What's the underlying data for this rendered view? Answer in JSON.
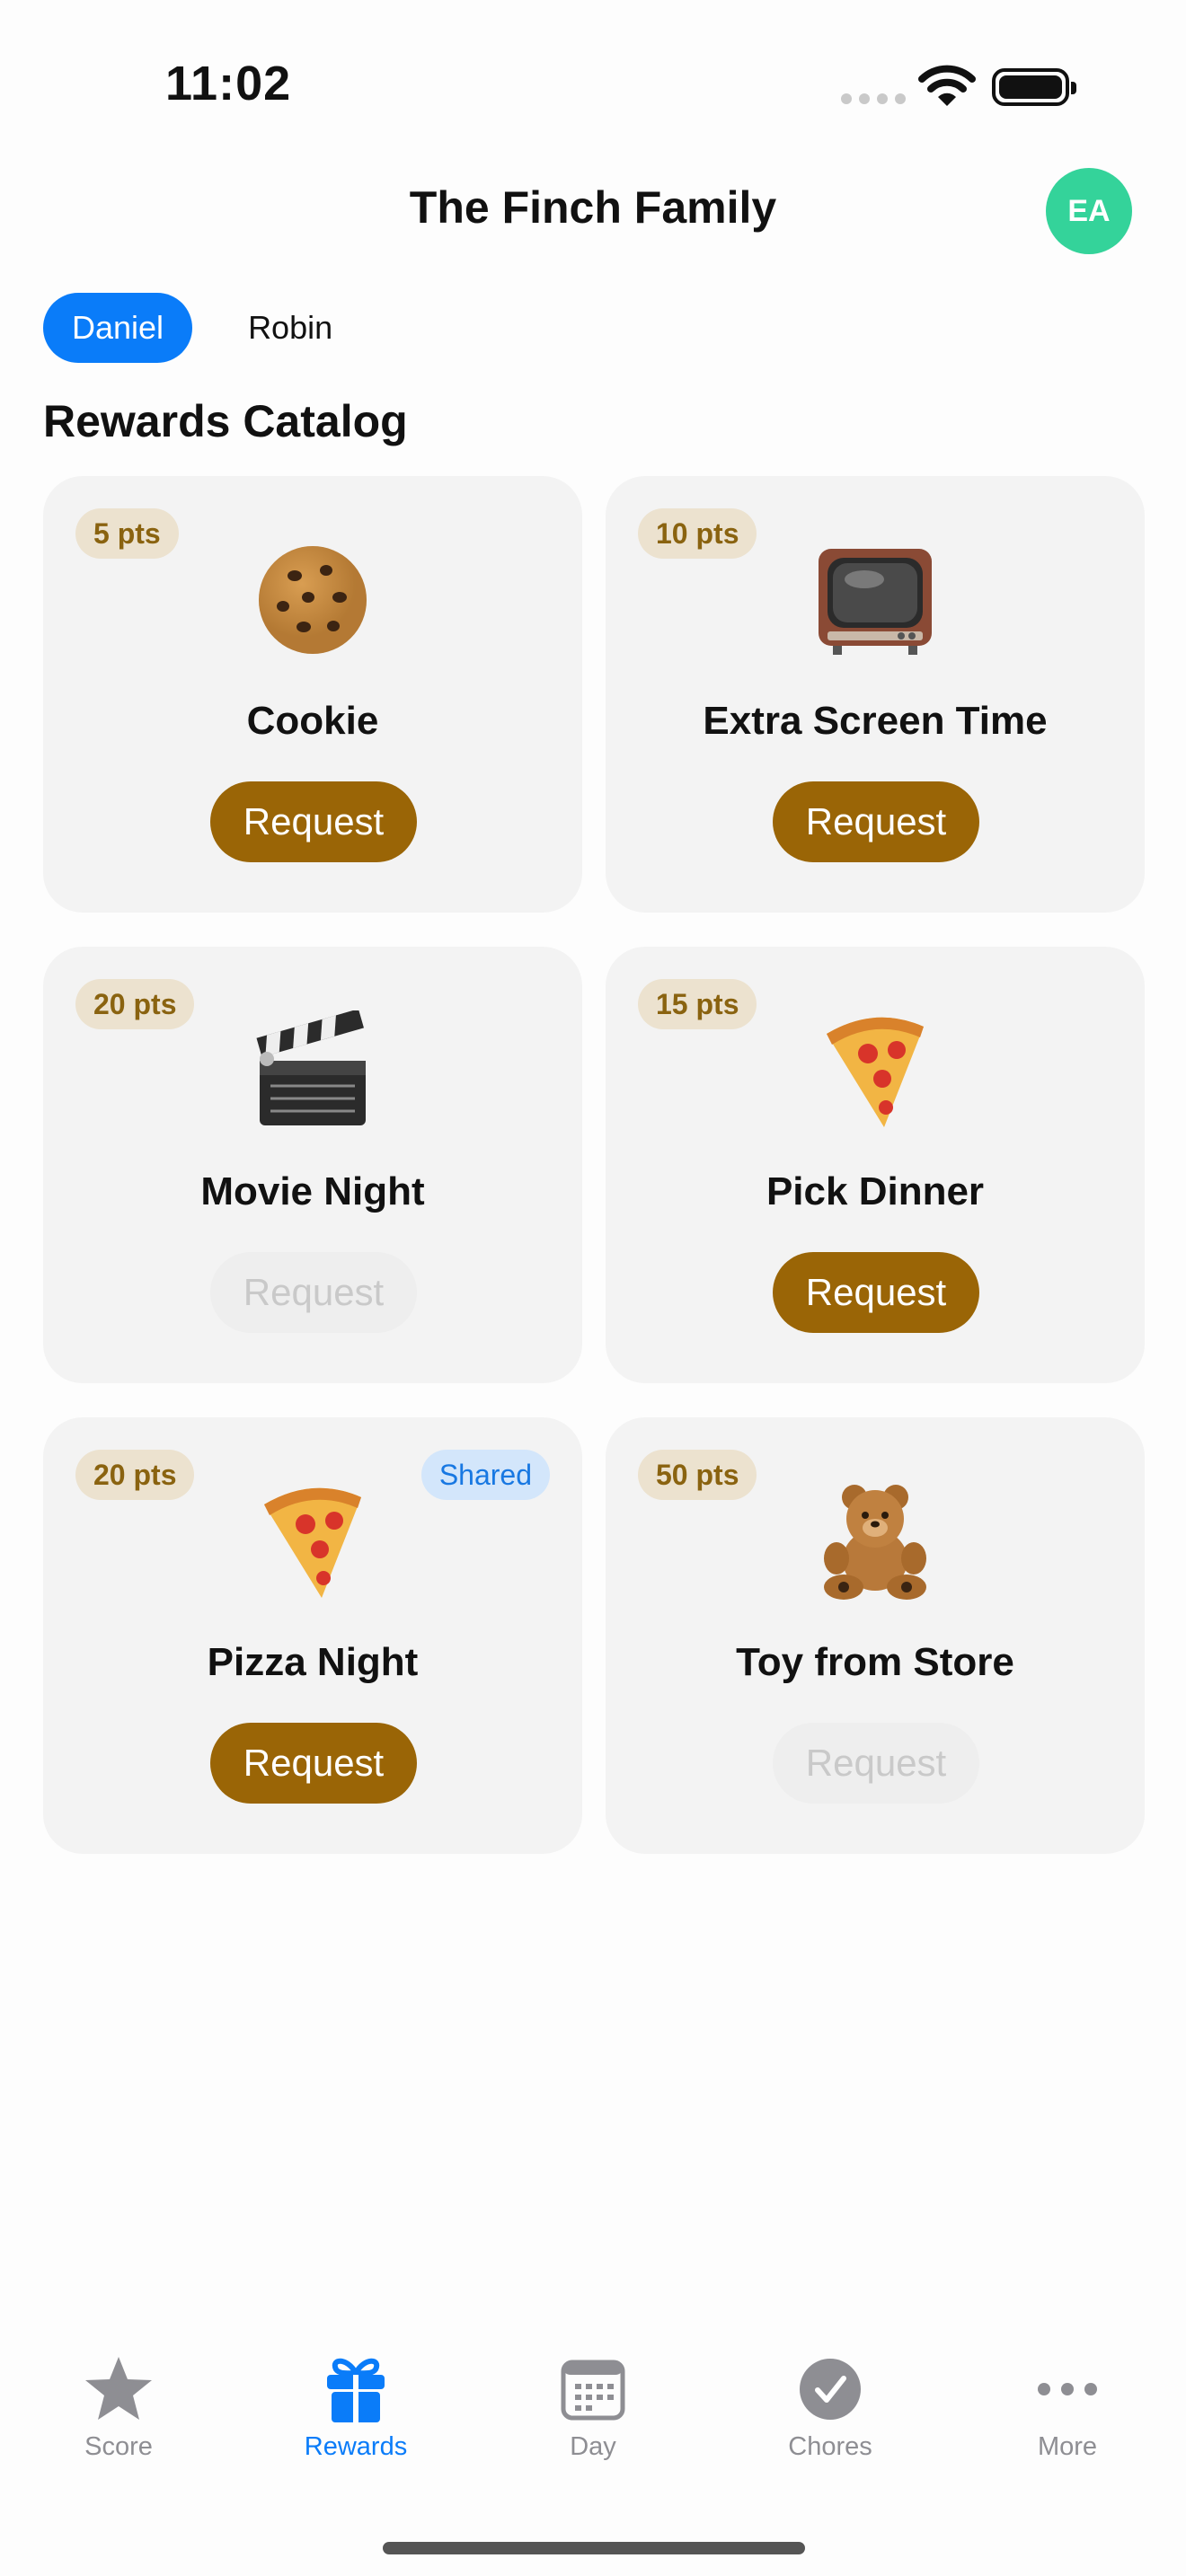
{
  "status_bar": {
    "time": "11:02"
  },
  "header": {
    "title": "The Finch Family",
    "avatar_initials": "EA",
    "avatar_color": "#34d39a"
  },
  "members": [
    {
      "label": "Daniel",
      "selected": true
    },
    {
      "label": "Robin",
      "selected": false
    }
  ],
  "section_title": "Rewards Catalog",
  "rewards": [
    {
      "points": "5 pts",
      "icon": "cookie-icon",
      "name": "Cookie",
      "request_label": "Request",
      "enabled": true,
      "shared": ""
    },
    {
      "points": "10 pts",
      "icon": "television-icon",
      "name": "Extra Screen Time",
      "request_label": "Request",
      "enabled": true,
      "shared": ""
    },
    {
      "points": "20 pts",
      "icon": "clapperboard-icon",
      "name": "Movie Night",
      "request_label": "Request",
      "enabled": false,
      "shared": ""
    },
    {
      "points": "15 pts",
      "icon": "pizza-slice-icon",
      "name": "Pick Dinner",
      "request_label": "Request",
      "enabled": true,
      "shared": ""
    },
    {
      "points": "20 pts",
      "icon": "pizza-slice-icon",
      "name": "Pizza Night",
      "request_label": "Request",
      "enabled": true,
      "shared": "Shared"
    },
    {
      "points": "50 pts",
      "icon": "teddy-bear-icon",
      "name": "Toy from Store",
      "request_label": "Request",
      "enabled": false,
      "shared": ""
    }
  ],
  "tab_bar": [
    {
      "label": "Score",
      "icon": "star-icon",
      "active": false
    },
    {
      "label": "Rewards",
      "icon": "gift-icon",
      "active": true
    },
    {
      "label": "Day",
      "icon": "calendar-icon",
      "active": false
    },
    {
      "label": "Chores",
      "icon": "checkmark-circle-icon",
      "active": false
    },
    {
      "label": "More",
      "icon": "ellipsis-icon",
      "active": false
    }
  ],
  "colors": {
    "accent": "#0a7cf9",
    "request_button": "#9a6506",
    "points_text": "#8a6310",
    "shared_text": "#1878e2"
  }
}
